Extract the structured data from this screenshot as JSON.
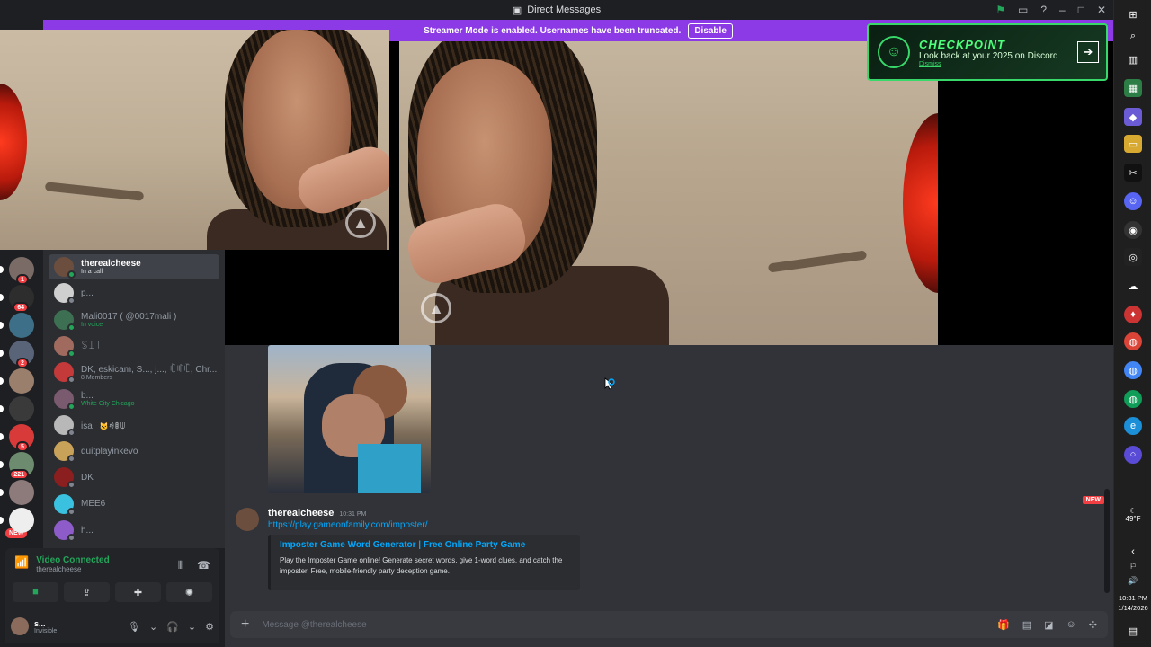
{
  "window": {
    "title": "Direct Messages"
  },
  "banner": {
    "text": "Streamer Mode is enabled. Usernames have been truncated.",
    "button": "Disable"
  },
  "checkpoint": {
    "title": "CHECKPOINT",
    "subtitle": "Look back at your 2025 on Discord",
    "dismiss": "Dismiss"
  },
  "servers": [
    {
      "badge": "1"
    },
    {
      "badge": "64"
    },
    {
      "badge": ""
    },
    {
      "badge": "2"
    },
    {
      "badge": ""
    },
    {
      "badge": ""
    },
    {
      "badge": "5"
    },
    {
      "badge": "221"
    },
    {
      "badge": ""
    },
    {
      "badge": ""
    }
  ],
  "rail_new": "NEW",
  "dms": [
    {
      "name": "therealcheese",
      "sub": "In a call",
      "active": true,
      "online": true
    },
    {
      "name": "p...",
      "sub": "",
      "online": false
    },
    {
      "name": "Mali0017 ( @0017mali )",
      "sub": "In voice",
      "online": true
    },
    {
      "name": "ꌗꀤ꓄",
      "sub": "",
      "online": true
    },
    {
      "name": "DK, eskicam, S..., j..., ꍟꎭꍟ, Chr...",
      "sub": "8 Members",
      "online": false
    },
    {
      "name": "b...",
      "sub": "White City Chicago",
      "online": true
    },
    {
      "name": "isa",
      "sub": "",
      "online": false
    },
    {
      "name": "quitplayinkevo",
      "sub": "",
      "online": false
    },
    {
      "name": "DK",
      "sub": "",
      "online": false
    },
    {
      "name": "MEE6",
      "sub": "",
      "online": false
    },
    {
      "name": "h...",
      "sub": "",
      "online": false
    }
  ],
  "dm_extra": {
    "isa_tag": "🐱ꆂꂦꅐ"
  },
  "voice": {
    "status": "Video Connected",
    "user": "therealcheese"
  },
  "user": {
    "name": "s...",
    "status": "Invisible"
  },
  "chat": {
    "new_tag": "NEW",
    "message": {
      "author": "therealcheese",
      "time": "10:31 PM",
      "link": "https://play.gameonfamily.com/imposter/",
      "embed_title": "Imposter Game Word Generator | Free Online Party Game",
      "embed_desc": "Play the Imposter Game online! Generate secret words, give 1-word clues, and catch the imposter. Free, mobile-friendly party deception game."
    },
    "input_placeholder": "Message @therealcheese"
  },
  "taskbar": {
    "weather": "49°F",
    "time": "10:31 PM",
    "date": "1/14/2026"
  },
  "colors": {
    "blurple": "#5865f2",
    "green": "#23a55a",
    "red": "#f23f43",
    "banner": "#8c3ae6",
    "link": "#00a8fc"
  }
}
